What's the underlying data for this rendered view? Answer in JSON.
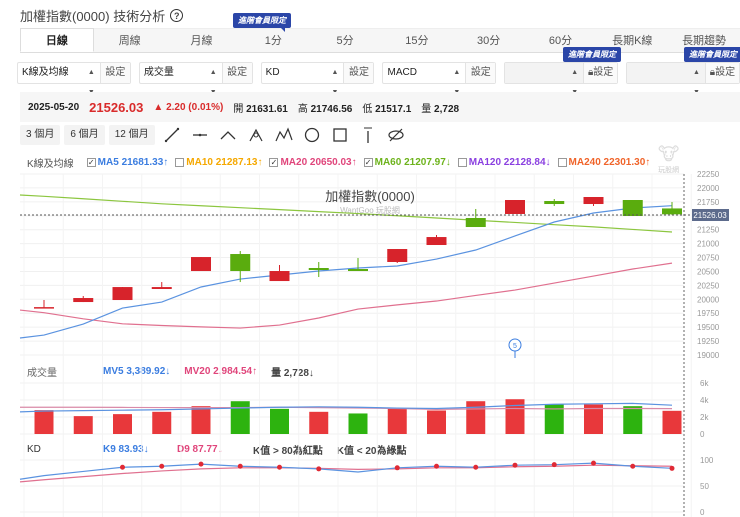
{
  "title": "加權指數(0000) 技術分析",
  "help_icon": "?",
  "tabs": [
    "日線",
    "周線",
    "月線",
    "1分",
    "5分",
    "15分",
    "30分",
    "60分",
    "長期K線",
    "長期趨勢"
  ],
  "member_badge": "進階會員限定",
  "selectors": [
    {
      "value": "K線及均線",
      "button": "設定"
    },
    {
      "value": "成交量",
      "button": "設定"
    },
    {
      "value": "KD",
      "button": "設定"
    },
    {
      "value": "MACD",
      "button": "設定"
    },
    {
      "value": "",
      "button": "設定",
      "locked": true
    },
    {
      "value": "",
      "button": "設定",
      "locked": true
    }
  ],
  "info": {
    "date": "2025-05-20",
    "close": "21526.03",
    "change": "▲ 2.20 (0.01%)",
    "open_label": "開",
    "open": "21631.61",
    "high_label": "高",
    "high": "21746.56",
    "low_label": "低",
    "low": "21517.1",
    "vol_label": "量",
    "vol": "2,728"
  },
  "ranges": [
    "3 個月",
    "6 個月",
    "12 個月"
  ],
  "tools": [
    "line-tool",
    "horizontal-line-tool",
    "angle-tool",
    "abc-pattern-tool",
    "abcd-pattern-tool",
    "circle-tool",
    "rectangle-tool",
    "text-tool",
    "hide-drawings-tool"
  ],
  "legend": {
    "label": "K線及均線",
    "items": [
      {
        "text": "MA5 21681.33↑",
        "checked": true,
        "color": "#3b7de0"
      },
      {
        "text": "MA10 21287.13↑",
        "checked": false,
        "color": "#f5a800"
      },
      {
        "text": "MA20 20650.03↑",
        "checked": true,
        "color": "#e0457b"
      },
      {
        "text": "MA60 21207.97↓",
        "checked": true,
        "color": "#6db31c"
      },
      {
        "text": "MA120 22128.84↓",
        "checked": false,
        "color": "#8a3fe0"
      },
      {
        "text": "MA240 22301.30↑",
        "checked": false,
        "color": "#f0642a"
      }
    ]
  },
  "watermark": {
    "title": "加權指數(0000)",
    "sub": "WantGoo 玩股網",
    "logo": "玩股網"
  },
  "price_tag": "21526.03",
  "event_marker": "5",
  "volume_legend": {
    "label": "成交量",
    "mv5": "MV5 3,389.92↓",
    "mv20": "MV20 2,984.54↑",
    "vol": "量 2,728↓"
  },
  "kd_legend": {
    "label": "KD",
    "k": "K9 83.93↓",
    "d": "D9 87.77↓",
    "rule1": "K值 > 80為紅點",
    "rule2": "K值 < 20為綠點"
  },
  "colors": {
    "up": "#d7232b",
    "down": "#5aac0e",
    "ma5": "#5b93e0",
    "ma20": "#e0708f",
    "ma60": "#8cc63f",
    "accent": "#2b46a8"
  },
  "chart_data": {
    "price_axis": {
      "min": 19000,
      "max": 22250,
      "ticks": [
        "22250",
        "22000",
        "21750",
        "21500",
        "21250",
        "21000",
        "20750",
        "20500",
        "20250",
        "20000",
        "19750",
        "19500",
        "19250",
        "19000"
      ]
    },
    "ohlc": [
      [
        19845,
        19987,
        19840,
        19860
      ],
      [
        19951,
        20059,
        19951,
        20023
      ],
      [
        19987,
        20220,
        19987,
        20220
      ],
      [
        20185,
        20310,
        20185,
        20220
      ],
      [
        20508,
        20759,
        20508,
        20759
      ],
      [
        20813,
        20867,
        20310,
        20508
      ],
      [
        20328,
        20616,
        20328,
        20508
      ],
      [
        20562,
        20670,
        20400,
        20526
      ],
      [
        20544,
        20742,
        20526,
        20508
      ],
      [
        20670,
        20903,
        20652,
        20903
      ],
      [
        20975,
        21154,
        20975,
        21118
      ],
      [
        21460,
        21622,
        21298,
        21298
      ],
      [
        21532,
        21783,
        21532,
        21783
      ],
      [
        21765,
        21801,
        21675,
        21711
      ],
      [
        21711,
        21837,
        21675,
        21837
      ],
      [
        21783,
        21783,
        21496,
        21496
      ],
      [
        21631.61,
        21746.56,
        21517.1,
        21526.03
      ]
    ],
    "ma5": [
      19358,
      19556,
      19843,
      19951,
      20221,
      20364,
      20436,
      20508,
      20562,
      20598,
      20723,
      20885,
      21137,
      21388,
      21550,
      21640,
      21681
    ],
    "ma20": [
      19760,
      19650,
      19560,
      19530,
      19505,
      19484,
      19538,
      19664,
      19825,
      19900,
      19969,
      20070,
      20166,
      20292,
      20418,
      20544,
      20650
    ],
    "ma60": [
      21849,
      21805,
      21760,
      21715,
      21680,
      21645,
      21610,
      21575,
      21540,
      21500,
      21460,
      21420,
      21380,
      21340,
      21300,
      21255,
      21208
    ],
    "volume_axis": {
      "max": 6000,
      "ticks": [
        "6k",
        "4k",
        "2k",
        "0"
      ]
    },
    "volume": [
      2805,
      2104,
      2338,
      2610,
      3273,
      3857,
      2961,
      2610,
      2416,
      2961,
      2766,
      3857,
      4091,
      3468,
      3468,
      3273,
      2728
    ],
    "volume_up": [
      true,
      true,
      true,
      true,
      true,
      false,
      false,
      true,
      false,
      true,
      true,
      true,
      true,
      false,
      true,
      false,
      true
    ],
    "mv5": [
      2700,
      2750,
      2800,
      2850,
      2950,
      3050,
      3150,
      3200,
      3150,
      3050,
      3000,
      3150,
      3350,
      3500,
      3550,
      3600,
      3390
    ],
    "mv20": [
      3150,
      3150,
      3130,
      3110,
      3100,
      3100,
      3150,
      3100,
      3050,
      3000,
      2900,
      2950,
      3000,
      2950,
      3000,
      3000,
      2985
    ],
    "kd_axis": {
      "ticks": [
        "100",
        "50",
        "0"
      ]
    },
    "k": [
      70,
      78,
      86,
      88,
      92,
      88,
      86,
      83,
      77,
      85,
      88,
      86,
      90,
      91,
      94,
      88,
      84
    ],
    "d": [
      62,
      68,
      74,
      79,
      83,
      85,
      85,
      84,
      82,
      83,
      85,
      85,
      87,
      88,
      90,
      89,
      88
    ]
  }
}
